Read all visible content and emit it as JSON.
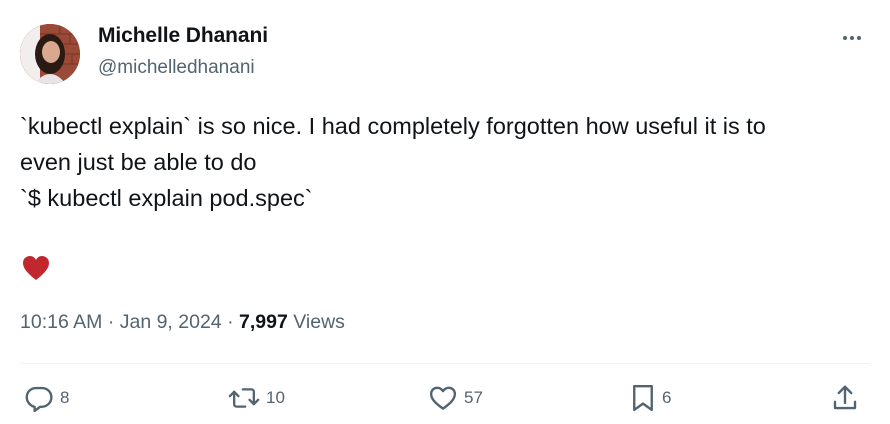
{
  "author": {
    "name": "Michelle Dhanani",
    "handle": "@michelledhanani"
  },
  "tweet": {
    "lines": [
      "`kubectl explain` is so nice. I had completely forgotten how useful it is to",
      "even just be able to do",
      "`$ kubectl explain pod.spec`"
    ],
    "emoji": "heart",
    "time": "10:16 AM",
    "date": "Jan 9, 2024",
    "separator": "·",
    "views_count": "7,997",
    "views_label": "Views"
  },
  "actions": {
    "replies": "8",
    "retweets": "10",
    "likes": "57",
    "bookmarks": "6"
  },
  "colors": {
    "text": "#0f1419",
    "secondary": "#536471",
    "heart": "#c1272d",
    "divider": "#eff3f4"
  },
  "icons": [
    "ellipsis-icon",
    "reply-icon",
    "retweet-icon",
    "like-icon",
    "bookmark-icon",
    "share-icon"
  ]
}
